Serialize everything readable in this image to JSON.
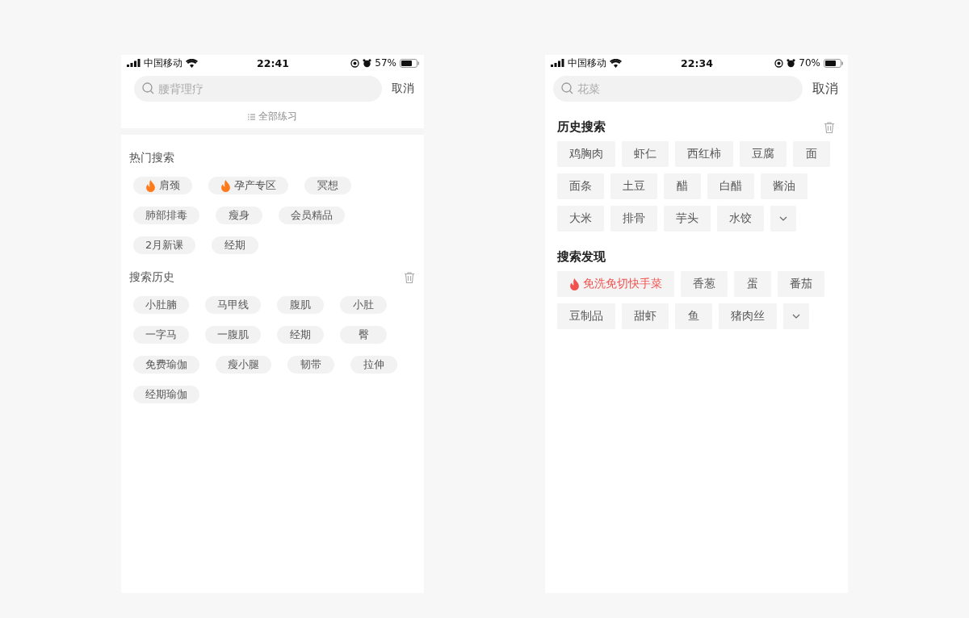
{
  "screens": [
    {
      "status_bar": {
        "carrier": "中国移动",
        "time": "22:41",
        "battery": "57%"
      },
      "search": {
        "placeholder": "腰背理疗",
        "cancel": "取消"
      },
      "all_practice": "全部练习",
      "sections": [
        {
          "title": "热门搜索",
          "clear_button": false,
          "tags": [
            {
              "label": "肩颈",
              "kind": "hot"
            },
            {
              "label": "孕产专区",
              "kind": "hot"
            },
            {
              "label": "冥想",
              "kind": "plain"
            },
            {
              "label": "肺部排毒",
              "kind": "plain"
            },
            {
              "label": "瘦身",
              "kind": "plain"
            },
            {
              "label": "会员精品",
              "kind": "plain"
            },
            {
              "label": "2月新课",
              "kind": "plain"
            },
            {
              "label": "经期",
              "kind": "plain"
            }
          ]
        },
        {
          "title": "搜索历史",
          "clear_button": true,
          "tags": [
            {
              "label": "小肚腩",
              "kind": "plain"
            },
            {
              "label": "马甲线",
              "kind": "plain"
            },
            {
              "label": "腹肌",
              "kind": "plain"
            },
            {
              "label": "小肚",
              "kind": "plain"
            },
            {
              "label": "一字马",
              "kind": "plain"
            },
            {
              "label": "一腹肌",
              "kind": "plain"
            },
            {
              "label": "经期",
              "kind": "plain"
            },
            {
              "label": "臀",
              "kind": "plain"
            },
            {
              "label": "免费瑜伽",
              "kind": "plain"
            },
            {
              "label": "瘦小腿",
              "kind": "plain"
            },
            {
              "label": "韧带",
              "kind": "plain"
            },
            {
              "label": "拉伸",
              "kind": "plain"
            },
            {
              "label": "经期瑜伽",
              "kind": "plain"
            }
          ]
        }
      ]
    },
    {
      "status_bar": {
        "carrier": "中国移动",
        "time": "22:34",
        "battery": "70%"
      },
      "search": {
        "placeholder": "花菜",
        "cancel": "取消"
      },
      "sections": [
        {
          "title": "历史搜索",
          "clear_button": true,
          "tags": [
            {
              "label": "鸡胸肉",
              "kind": "plain"
            },
            {
              "label": "虾仁",
              "kind": "plain"
            },
            {
              "label": "西红柿",
              "kind": "plain"
            },
            {
              "label": "豆腐",
              "kind": "plain"
            },
            {
              "label": "面",
              "kind": "plain"
            },
            {
              "label": "面条",
              "kind": "plain"
            },
            {
              "label": "土豆",
              "kind": "plain"
            },
            {
              "label": "醋",
              "kind": "plain"
            },
            {
              "label": "白醋",
              "kind": "plain"
            },
            {
              "label": "酱油",
              "kind": "plain"
            },
            {
              "label": "大米",
              "kind": "plain"
            },
            {
              "label": "排骨",
              "kind": "plain"
            },
            {
              "label": "芋头",
              "kind": "plain"
            },
            {
              "label": "水饺",
              "kind": "plain"
            },
            {
              "kind": "more"
            }
          ]
        },
        {
          "title": "搜索发现",
          "clear_button": false,
          "tags": [
            {
              "label": "免洗免切快手菜",
              "kind": "hot"
            },
            {
              "label": "香葱",
              "kind": "plain"
            },
            {
              "label": "蛋",
              "kind": "plain"
            },
            {
              "label": "番茄",
              "kind": "plain"
            },
            {
              "label": "豆制品",
              "kind": "plain"
            },
            {
              "label": "甜虾",
              "kind": "plain"
            },
            {
              "label": "鱼",
              "kind": "plain"
            },
            {
              "label": "猪肉丝",
              "kind": "plain"
            },
            {
              "kind": "more"
            }
          ]
        }
      ]
    }
  ]
}
